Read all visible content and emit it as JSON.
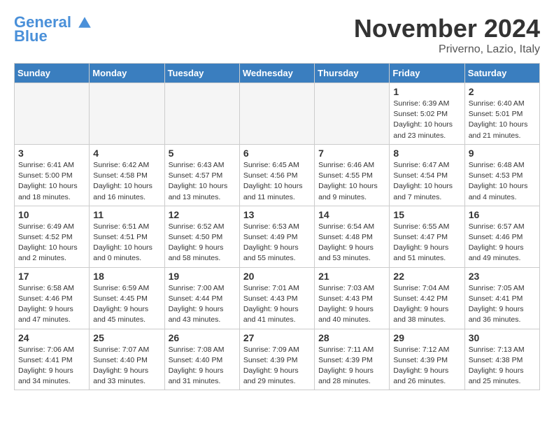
{
  "header": {
    "logo_line1": "General",
    "logo_line2": "Blue",
    "month_title": "November 2024",
    "location": "Priverno, Lazio, Italy"
  },
  "weekdays": [
    "Sunday",
    "Monday",
    "Tuesday",
    "Wednesday",
    "Thursday",
    "Friday",
    "Saturday"
  ],
  "weeks": [
    [
      {
        "day": "",
        "info": ""
      },
      {
        "day": "",
        "info": ""
      },
      {
        "day": "",
        "info": ""
      },
      {
        "day": "",
        "info": ""
      },
      {
        "day": "",
        "info": ""
      },
      {
        "day": "1",
        "info": "Sunrise: 6:39 AM\nSunset: 5:02 PM\nDaylight: 10 hours\nand 23 minutes."
      },
      {
        "day": "2",
        "info": "Sunrise: 6:40 AM\nSunset: 5:01 PM\nDaylight: 10 hours\nand 21 minutes."
      }
    ],
    [
      {
        "day": "3",
        "info": "Sunrise: 6:41 AM\nSunset: 5:00 PM\nDaylight: 10 hours\nand 18 minutes."
      },
      {
        "day": "4",
        "info": "Sunrise: 6:42 AM\nSunset: 4:58 PM\nDaylight: 10 hours\nand 16 minutes."
      },
      {
        "day": "5",
        "info": "Sunrise: 6:43 AM\nSunset: 4:57 PM\nDaylight: 10 hours\nand 13 minutes."
      },
      {
        "day": "6",
        "info": "Sunrise: 6:45 AM\nSunset: 4:56 PM\nDaylight: 10 hours\nand 11 minutes."
      },
      {
        "day": "7",
        "info": "Sunrise: 6:46 AM\nSunset: 4:55 PM\nDaylight: 10 hours\nand 9 minutes."
      },
      {
        "day": "8",
        "info": "Sunrise: 6:47 AM\nSunset: 4:54 PM\nDaylight: 10 hours\nand 7 minutes."
      },
      {
        "day": "9",
        "info": "Sunrise: 6:48 AM\nSunset: 4:53 PM\nDaylight: 10 hours\nand 4 minutes."
      }
    ],
    [
      {
        "day": "10",
        "info": "Sunrise: 6:49 AM\nSunset: 4:52 PM\nDaylight: 10 hours\nand 2 minutes."
      },
      {
        "day": "11",
        "info": "Sunrise: 6:51 AM\nSunset: 4:51 PM\nDaylight: 10 hours\nand 0 minutes."
      },
      {
        "day": "12",
        "info": "Sunrise: 6:52 AM\nSunset: 4:50 PM\nDaylight: 9 hours\nand 58 minutes."
      },
      {
        "day": "13",
        "info": "Sunrise: 6:53 AM\nSunset: 4:49 PM\nDaylight: 9 hours\nand 55 minutes."
      },
      {
        "day": "14",
        "info": "Sunrise: 6:54 AM\nSunset: 4:48 PM\nDaylight: 9 hours\nand 53 minutes."
      },
      {
        "day": "15",
        "info": "Sunrise: 6:55 AM\nSunset: 4:47 PM\nDaylight: 9 hours\nand 51 minutes."
      },
      {
        "day": "16",
        "info": "Sunrise: 6:57 AM\nSunset: 4:46 PM\nDaylight: 9 hours\nand 49 minutes."
      }
    ],
    [
      {
        "day": "17",
        "info": "Sunrise: 6:58 AM\nSunset: 4:46 PM\nDaylight: 9 hours\nand 47 minutes."
      },
      {
        "day": "18",
        "info": "Sunrise: 6:59 AM\nSunset: 4:45 PM\nDaylight: 9 hours\nand 45 minutes."
      },
      {
        "day": "19",
        "info": "Sunrise: 7:00 AM\nSunset: 4:44 PM\nDaylight: 9 hours\nand 43 minutes."
      },
      {
        "day": "20",
        "info": "Sunrise: 7:01 AM\nSunset: 4:43 PM\nDaylight: 9 hours\nand 41 minutes."
      },
      {
        "day": "21",
        "info": "Sunrise: 7:03 AM\nSunset: 4:43 PM\nDaylight: 9 hours\nand 40 minutes."
      },
      {
        "day": "22",
        "info": "Sunrise: 7:04 AM\nSunset: 4:42 PM\nDaylight: 9 hours\nand 38 minutes."
      },
      {
        "day": "23",
        "info": "Sunrise: 7:05 AM\nSunset: 4:41 PM\nDaylight: 9 hours\nand 36 minutes."
      }
    ],
    [
      {
        "day": "24",
        "info": "Sunrise: 7:06 AM\nSunset: 4:41 PM\nDaylight: 9 hours\nand 34 minutes."
      },
      {
        "day": "25",
        "info": "Sunrise: 7:07 AM\nSunset: 4:40 PM\nDaylight: 9 hours\nand 33 minutes."
      },
      {
        "day": "26",
        "info": "Sunrise: 7:08 AM\nSunset: 4:40 PM\nDaylight: 9 hours\nand 31 minutes."
      },
      {
        "day": "27",
        "info": "Sunrise: 7:09 AM\nSunset: 4:39 PM\nDaylight: 9 hours\nand 29 minutes."
      },
      {
        "day": "28",
        "info": "Sunrise: 7:11 AM\nSunset: 4:39 PM\nDaylight: 9 hours\nand 28 minutes."
      },
      {
        "day": "29",
        "info": "Sunrise: 7:12 AM\nSunset: 4:39 PM\nDaylight: 9 hours\nand 26 minutes."
      },
      {
        "day": "30",
        "info": "Sunrise: 7:13 AM\nSunset: 4:38 PM\nDaylight: 9 hours\nand 25 minutes."
      }
    ]
  ]
}
